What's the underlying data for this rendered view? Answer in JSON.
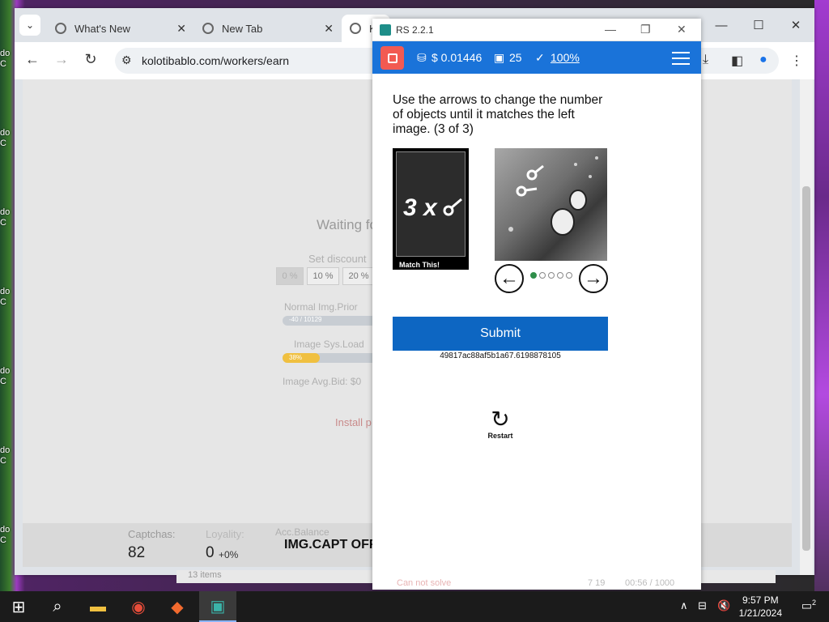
{
  "browser": {
    "tabs": [
      {
        "label": "What's New"
      },
      {
        "label": "New Tab"
      },
      {
        "label": "K"
      }
    ],
    "url": "kolotibablo.com/workers/earn"
  },
  "page": {
    "waiting": "Waiting fo",
    "set_discount": "Set discount",
    "discount_options": [
      "0 %",
      "10 %",
      "20 %"
    ],
    "normal_img_priority": "Normal Img.Prior",
    "normal_bar_text": "-40 / 10129",
    "image_sys_load": "Image Sys.Load",
    "sys_load_value": "38%",
    "image_avg_bid": "Image Avg.Bid: $0",
    "install": "Install p",
    "captchas_label": "Captchas:",
    "captchas_value": "82",
    "loyalty_label": "Loyality:",
    "loyalty_value": "0",
    "loyalty_delta": "+0%",
    "acc_balance": "Acc.Balance",
    "img_capt": "IMG.CAPT OFF",
    "items": "13 items"
  },
  "extension": {
    "title": "RS 2.2.1",
    "balance": "$ 0.01446",
    "count": "25",
    "percent": "100%",
    "instruction": "Use the arrows to change the number of objects until it matches the left image. (3 of 3)",
    "left_label": "3 x",
    "match_label": "Match This!",
    "submit_label": "Submit",
    "hash": "49817ac88af5b1a67.6198878105",
    "restart_label": "Restart",
    "footer_left": "Can not solve",
    "footer_mid": "7 19",
    "footer_right": "00:56 / 1000"
  },
  "desktop_icons": [
    "do C",
    "do C",
    "do C",
    "do C",
    "do C",
    "do C",
    "do C"
  ],
  "taskbar": {
    "time": "9:57 PM",
    "date": "1/21/2024",
    "notifications": "2"
  },
  "colors": {
    "blue_bar": "#1a73d9",
    "stop": "#f25a52",
    "submit": "#0d66c2"
  },
  "icons": [
    "chrome-icon",
    "reload-icon",
    "download-icon",
    "sidebar-icon",
    "profile-icon",
    "more-icon",
    "stop-icon",
    "coin-icon",
    "image-icon",
    "check-icon",
    "menu-icon",
    "restart-icon"
  ]
}
